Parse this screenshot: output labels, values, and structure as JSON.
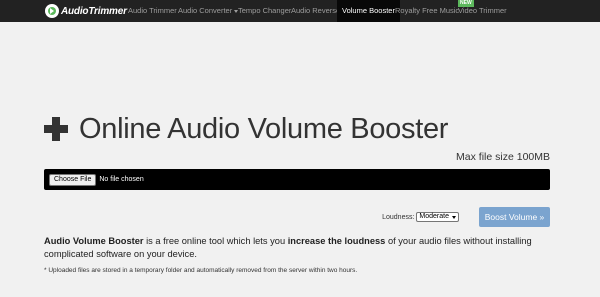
{
  "nav": {
    "logo": "AudioTrimmer",
    "items": [
      {
        "label": "Audio Trimmer"
      },
      {
        "label": "Audio Converter"
      },
      {
        "label": "Tempo Changer"
      },
      {
        "label": "Audio Reverser"
      },
      {
        "label": "Volume Booster"
      },
      {
        "label": "Royalty Free Music"
      },
      {
        "label": "Video Trimmer"
      }
    ],
    "new_badge": "NEW"
  },
  "main": {
    "title": "Online Audio Volume Booster",
    "max_size": "Max file size 100MB",
    "file_button": "Choose File",
    "file_status": "No file chosen",
    "loudness_label": "Loudness:",
    "loudness_value": "Moderate",
    "boost_button": "Boost Volume »",
    "desc": {
      "part1": "Audio Volume Booster",
      "part2": " is a free online tool which lets you ",
      "part3": "increase the loudness",
      "part4": " of your audio files without installing complicated software on your device."
    },
    "note": "* Uploaded files are stored in a temporary folder and automatically removed from the server within two hours."
  },
  "colors": {
    "navbar": "#222222",
    "active_tab": "#080808",
    "badge": "#5cb85c",
    "boost_button": "#7ba4cf",
    "background": "#f1f1f1"
  }
}
